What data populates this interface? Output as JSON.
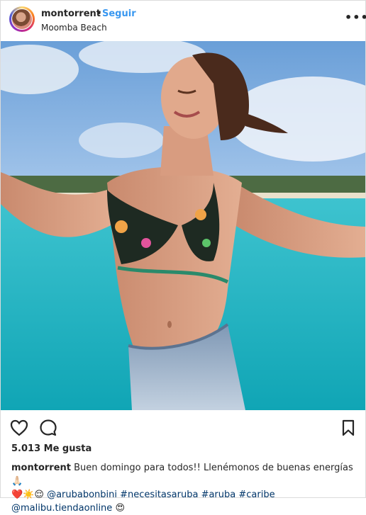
{
  "header": {
    "username": "montorrent",
    "separator": "•",
    "follow_label": "Seguir",
    "location": "Moomba Beach",
    "more_label": "•••"
  },
  "post": {
    "likes": "5.013 Me gusta",
    "caption": {
      "username": "montorrent",
      "text_line1": "Buen domingo para todos!! Llenémonos de buenas energías",
      "emoji_line1": "🙏🏻",
      "emoji_line2": "❤️☀️😌",
      "mention_1": "@arubabonbini",
      "hashtag_1": "#necesitasaruba",
      "hashtag_2": "#aruba",
      "hashtag_3": "#caribe",
      "mention_2": "@malibu.tiendaonline",
      "emoji_line3": "😍"
    }
  },
  "icons": {
    "like": "heart-icon",
    "comment": "comment-icon",
    "save": "bookmark-icon"
  }
}
